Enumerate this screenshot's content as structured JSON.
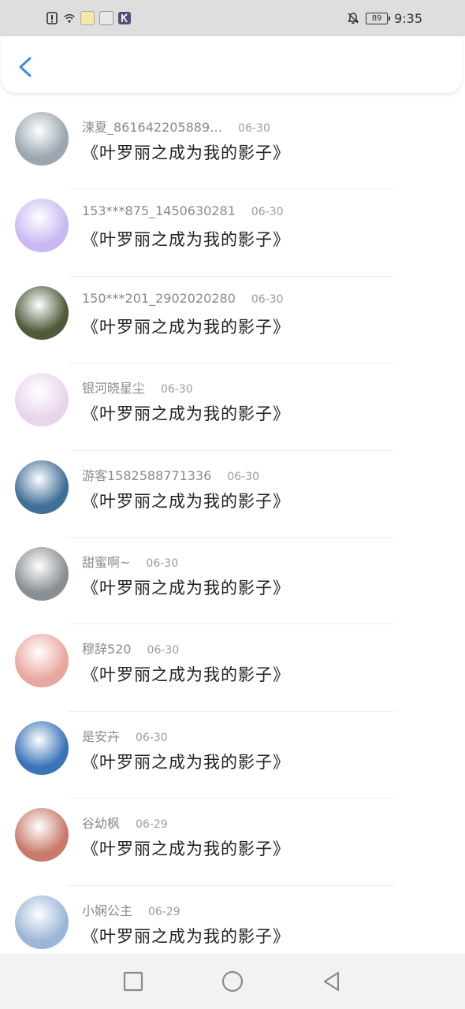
{
  "statusbar": {
    "time": "9:35",
    "battery": "89",
    "icons_left": [
      "alert-icon",
      "wifi-icon",
      "app-icon-1",
      "app-icon-2",
      "app-icon-k"
    ],
    "icons_right": [
      "mute-bell-icon",
      "battery-icon"
    ]
  },
  "header": {
    "back_icon": "back-chevron-icon",
    "accent": "#3a8ee6"
  },
  "items": [
    {
      "name": "涑夏_861642205889…",
      "date": "06-30",
      "title": "《叶罗丽之成为我的影子》",
      "avatar_color": "#9aa6b0"
    },
    {
      "name": "153***875_1450630281",
      "date": "06-30",
      "title": "《叶罗丽之成为我的影子》",
      "avatar_color": "#c9b8f2"
    },
    {
      "name": "150***201_2902020280",
      "date": "06-30",
      "title": "《叶罗丽之成为我的影子》",
      "avatar_color": "#4e5a3a"
    },
    {
      "name": "银河晓星尘",
      "date": "06-30",
      "title": "《叶罗丽之成为我的影子》",
      "avatar_color": "#e8d5ec"
    },
    {
      "name": "游客1582588771336",
      "date": "06-30",
      "title": "《叶罗丽之成为我的影子》",
      "avatar_color": "#3f6f96"
    },
    {
      "name": "甜蜜啊~",
      "date": "06-30",
      "title": "《叶罗丽之成为我的影子》",
      "avatar_color": "#8a8f94"
    },
    {
      "name": "穆辞520",
      "date": "06-30",
      "title": "《叶罗丽之成为我的影子》",
      "avatar_color": "#e9a6a0"
    },
    {
      "name": "是安卉",
      "date": "06-30",
      "title": "《叶罗丽之成为我的影子》",
      "avatar_color": "#3a74b8"
    },
    {
      "name": "谷幼枫",
      "date": "06-29",
      "title": "《叶罗丽之成为我的影子》",
      "avatar_color": "#c97a6a"
    },
    {
      "name": "小娴公主",
      "date": "06-29",
      "title": "《叶罗丽之成为我的影子》",
      "avatar_color": "#9bb6d8"
    }
  ],
  "navbar": {
    "icons": [
      "recent-apps-icon",
      "home-icon",
      "back-icon"
    ]
  }
}
